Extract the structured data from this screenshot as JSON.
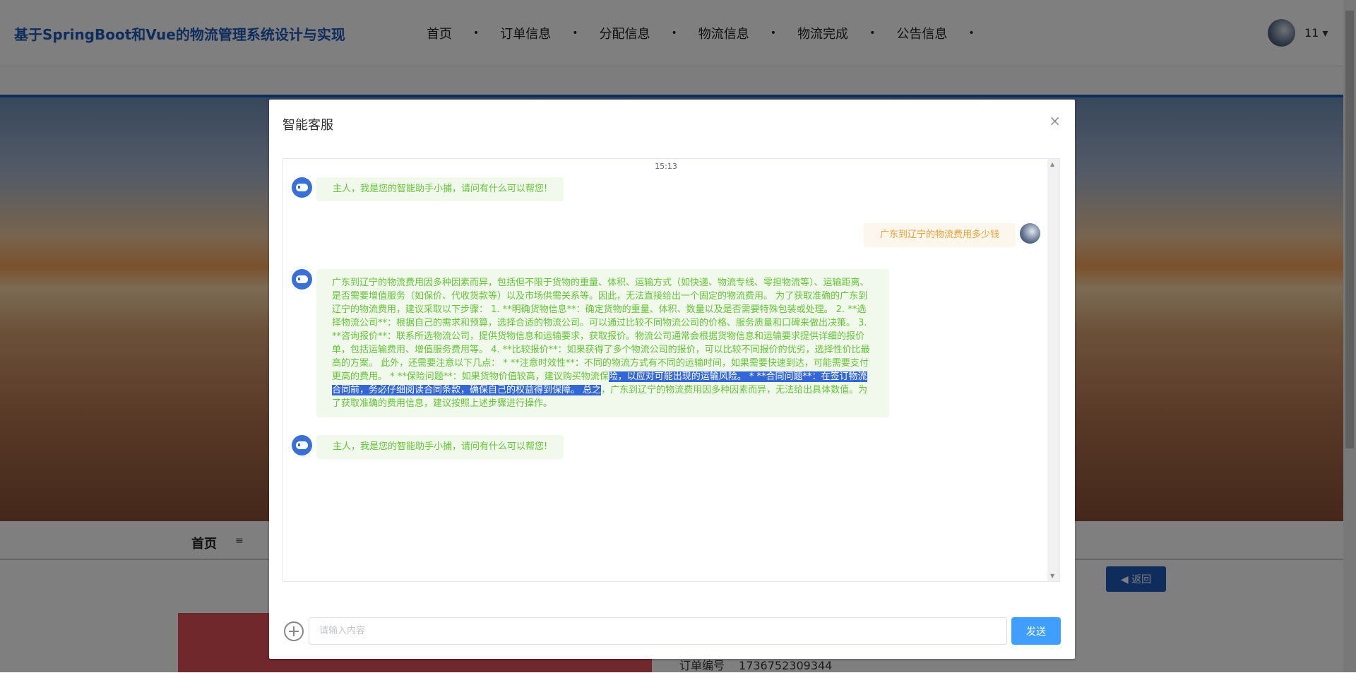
{
  "header": {
    "title": "基于SpringBoot和Vue的物流管理系统设计与实现",
    "nav": [
      "首页",
      "订单信息",
      "分配信息",
      "物流信息",
      "物流完成",
      "公告信息"
    ],
    "user": "11 ▾"
  },
  "page": {
    "breadcrumb_home": "首页",
    "breadcrumb_sep": "≡",
    "back_label": "◀ 返回",
    "order_no_label": "订单编号",
    "order_no": "1736752309344"
  },
  "modal": {
    "title": "智能客服",
    "close": "×",
    "time": "15:13",
    "greeting": "主人，我是您的智能助手小捕，请问有什么可以帮您!",
    "user_msg": "广东到辽宁的物流费用多少钱",
    "reply_part1": "广东到辽宁的物流费用因多种因素而异，包括但不限于货物的重量、体积、运输方式（如快递、物流专线、零担物流等）、运输距离、是否需要增值服务（如保价、代收货款等）以及市场供需关系等。因此，无法直接给出一个固定的物流费用。 为了获取准确的广东到辽宁的物流费用，建议采取以下步骤： 1. **明确货物信息**：确定货物的重量、体积、数量以及是否需要特殊包装或处理。 2. **选择物流公司**：根据自己的需求和预算，选择合适的物流公司。可以通过比较不同物流公司的价格、服务质量和口碑来做出决策。 3. **咨询报价**：联系所选物流公司，提供货物信息和运输要求，获取报价。物流公司通常会根据货物信息和运输要求提供详细的报价单，包括运输费用、增值服务费用等。 4. **比较报价**：如果获得了多个物流公司的报价，可以比较不同报价的优劣，选择性价比最高的方案。 此外，还需要注意以下几点： * **注意时效性**：不同的物流方式有不同的运输时间，如果需要快速到达，可能需要支付更高的费用。 * **保险问题**：如果货物价值较高，建议购买物流保",
    "reply_selected": "险，以应对可能出现的运输风险。 * **合同问题**：在签订物流合同前，务必仔细阅读合同条款，确保自己的权益得到保障。 总之",
    "reply_part3": "，广东到辽宁的物流费用因多种因素而异，无法给出具体数值。为了获取准确的费用信息，建议按照上述步骤进行操作。",
    "greeting2": "主人，我是您的智能助手小捕，请问有什么可以帮您!",
    "placeholder": "请输入内容",
    "send": "发送"
  }
}
